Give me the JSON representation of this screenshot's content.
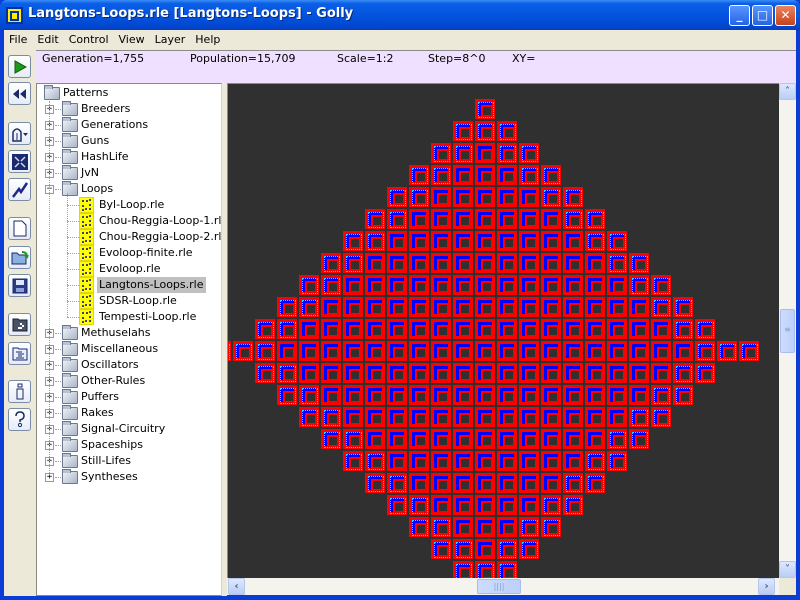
{
  "window": {
    "title": "Langtons-Loops.rle [Langtons-Loops] - Golly",
    "controls": {
      "minimize": "_",
      "maximize": "□",
      "close": "✕"
    }
  },
  "menubar": {
    "items": [
      "File",
      "Edit",
      "Control",
      "View",
      "Layer",
      "Help"
    ]
  },
  "status": {
    "generation": "Generation=1,755",
    "population": "Population=15,709",
    "scale": "Scale=1:2",
    "step": "Step=8^0",
    "xy": "XY="
  },
  "toolbar": {
    "buttons": [
      {
        "name": "start-button",
        "icon": "play-icon"
      },
      {
        "name": "reset-button",
        "icon": "rewind-icon"
      },
      {
        "name": "algorithm-button",
        "icon": "algorithm-icon"
      },
      {
        "name": "fit-button",
        "icon": "fit-icon"
      },
      {
        "name": "hashing-button",
        "icon": "hash-icon"
      },
      {
        "name": "new-button",
        "icon": "new-file-icon"
      },
      {
        "name": "open-button",
        "icon": "open-folder-icon"
      },
      {
        "name": "save-button",
        "icon": "save-icon"
      },
      {
        "name": "patterns-button",
        "icon": "patterns-icon"
      },
      {
        "name": "scripts-button",
        "icon": "scripts-icon"
      },
      {
        "name": "info-button",
        "icon": "info-icon"
      },
      {
        "name": "help-button",
        "icon": "help-icon"
      }
    ]
  },
  "tree": {
    "root": "Patterns",
    "folders_before": [
      "Breeders",
      "Generations",
      "Guns",
      "HashLife",
      "JvN"
    ],
    "expanded_folder": "Loops",
    "files": [
      "Byl-Loop.rle",
      "Chou-Reggia-Loop-1.rle",
      "Chou-Reggia-Loop-2.rle",
      "Evoloop-finite.rle",
      "Evoloop.rle",
      "Langtons-Loops.rle",
      "SDSR-Loop.rle",
      "Tempesti-Loop.rle"
    ],
    "selected_file": "Langtons-Loops.rle",
    "folders_after": [
      "Methuselahs",
      "Miscellaneous",
      "Oscillators",
      "Other-Rules",
      "Puffers",
      "Rakes",
      "Signal-Circuitry",
      "Spaceships",
      "Still-Lifes",
      "Syntheses"
    ]
  },
  "colors": {
    "titlebar": "#0554e0",
    "status_bg": "#f0e0ff",
    "viewport_bg": "#303030",
    "loop_sheath": "#ff0000",
    "loop_core": "#0000ff",
    "signal_cyan": "#00e5ff",
    "signal_yellow": "#ffff00",
    "signal_green": "#00ff00",
    "selection": "#c0c0c0"
  },
  "scrollbars": {
    "vertical_position": 0.48,
    "horizontal_position": 0.5
  }
}
